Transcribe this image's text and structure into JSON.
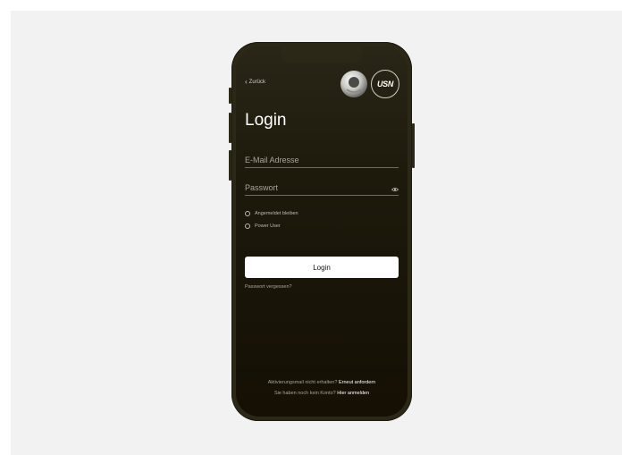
{
  "nav": {
    "back_label": "Zurück"
  },
  "logos": {
    "usn_text": "USN"
  },
  "form": {
    "title": "Login",
    "email_placeholder": "E-Mail Adresse",
    "password_placeholder": "Passwort",
    "options": [
      {
        "label": "Angemeldet bleiben",
        "checked": false
      },
      {
        "label": "Power User",
        "checked": false
      }
    ],
    "login_button": "Login",
    "forgot_link": "Passwort vergessen?"
  },
  "footer": {
    "activation_text": "Aktivierungsmail nicht erhalten?",
    "activation_link": "Erneut anfordern",
    "signup_text": "Sie haben noch kein Konto?",
    "signup_link": "Hier anmelden"
  },
  "colors": {
    "background": "#f2f2f2",
    "phone_frame": "#2b2817",
    "screen_top": "#2a2617",
    "screen_bottom": "#150f04",
    "button_bg": "#ffffff",
    "muted_text": "#a8a59b"
  }
}
